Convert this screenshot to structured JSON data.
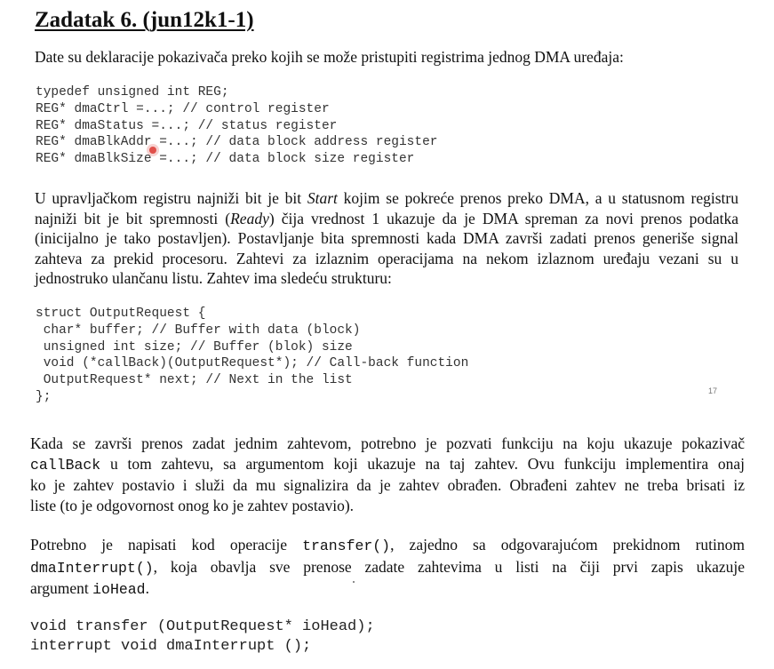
{
  "title": "Zadatak 6. (jun12k1-1)",
  "intro": "Date su deklaracije pokazivača preko kojih se može pristupiti registrima jednog DMA uređaja:",
  "code1": [
    "typedef unsigned int REG;",
    "REG* dmaCtrl =...; // control register",
    "REG* dmaStatus =...; // status register",
    "REG* dmaBlkAddr =...; // data block address register",
    "REG* dmaBlkSize =...; // data block size register"
  ],
  "para2": {
    "l1": [
      "U upravljačkom registru najniži bit je bit ",
      "Start",
      " kojim se pokreće prenos preko DMA, a u statusnom registru"
    ],
    "l2": [
      "najniži bit je bit spremnosti (",
      "Ready",
      ") čija vrednost 1 ukazuje da je DMA spreman za novi prenos podatka"
    ],
    "l3": "(inicijalno je tako postavljen). Postavljanje bita spremnosti kada DMA završi zadati prenos generiše signal",
    "l4": "zahteva za prekid procesoru. Zahtevi za izlaznim operacijama na nekom izlaznom uređaju vezani su u",
    "l5": "jednostruko ulančanu listu. Zahtev ima sledeću strukturu:"
  },
  "code2": [
    "struct OutputRequest {",
    " char* buffer; // Buffer with data (block)",
    " unsigned int size; // Buffer (blok) size",
    " void (*callBack)(OutputRequest*); // Call-back function",
    " OutputRequest* next; // Next in the list",
    "};"
  ],
  "page_number": "17",
  "para3": {
    "l1": "Kada se završi prenos zadat jednim zahtevom, potrebno je pozvati funkciju na koju ukazuje pokazivač",
    "l2": [
      "callBack",
      " u tom zahtevu, sa argumentom koji ukazuje na taj zahtev. Ovu funkciju implementira onaj"
    ],
    "l3": "ko je zahtev postavio i služi da mu signalizira da je zahtev obrađen. Obrađeni zahtev ne treba brisati iz",
    "l4": "liste (to je odgovornost onog ko je zahtev postavio)."
  },
  "para4": {
    "l1": [
      "Potrebno je napisati kod operacije ",
      "transfer()",
      ", zajedno sa odgovarajućom prekidnom rutinom"
    ],
    "l2": [
      "dmaInterrupt()",
      ", koja obavlja sve prenose zadate zahtevima u listi na čiji prvi zapis ukazuje"
    ],
    "l3": [
      "argument ",
      "ioHead",
      "."
    ]
  },
  "code3": [
    "void transfer (OutputRequest* ioHead);",
    "interrupt void dmaInterrupt ();"
  ]
}
